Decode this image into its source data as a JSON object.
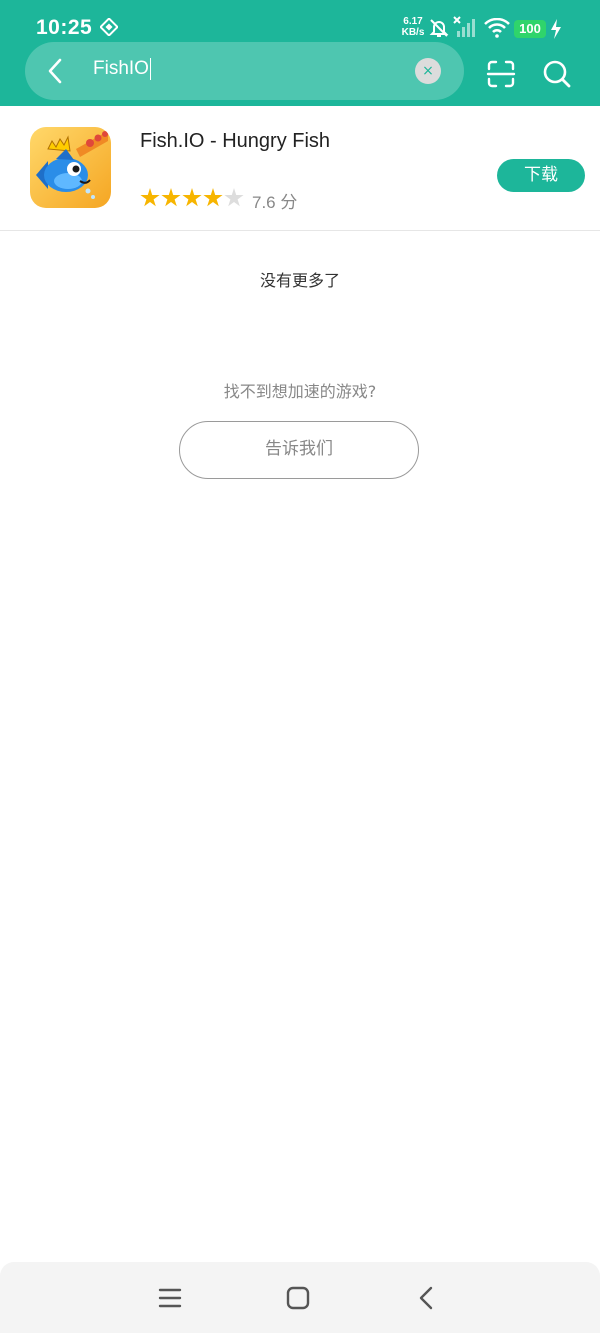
{
  "status_bar": {
    "time": "10:25",
    "net_speed_value": "6.17",
    "net_speed_unit": "KB/s",
    "battery": "100",
    "icons": [
      "vpn-diamond-icon",
      "mute-bell-icon",
      "signal-x-icon",
      "signal-bars-icon",
      "wifi-icon",
      "charging-bolt-icon"
    ]
  },
  "search": {
    "query": "FishIO",
    "clear_glyph": "×",
    "icons": [
      "back-arrow-icon",
      "clear-icon",
      "scan-icon",
      "search-icon"
    ]
  },
  "result": {
    "title": "Fish.IO - Hungry Fish",
    "rating_stars": 4,
    "rating_text": "7.6 分",
    "download_label": "下载",
    "icon": "fish-game-icon"
  },
  "footer_text": {
    "no_more": "没有更多了",
    "not_found": "找不到想加速的游戏?",
    "tell_us": "告诉我们"
  },
  "nav_bar": {
    "icons": [
      "menu-icon",
      "home-icon",
      "back-icon"
    ]
  },
  "colors": {
    "brand": "#1db69a",
    "star_filled": "#f7b500",
    "star_empty": "#dddddd",
    "battery": "#2fd46b"
  }
}
